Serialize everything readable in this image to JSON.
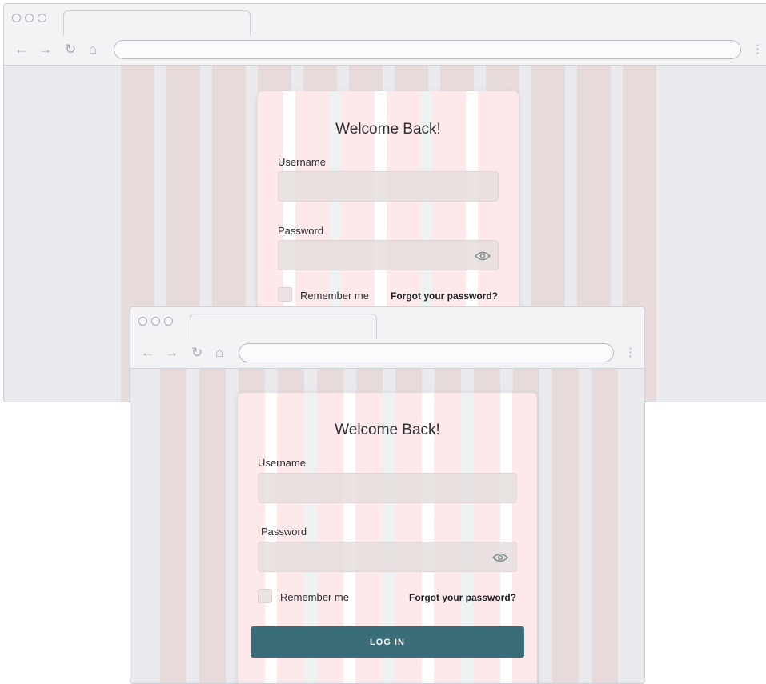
{
  "login_form": {
    "title": "Welcome Back!",
    "username_label": "Username",
    "password_label": "Password",
    "remember_label": "Remember me",
    "forgot_label": "Forgot your password?",
    "login_label": "LOG IN"
  },
  "browser": {
    "nav_icons": [
      "back-arrow-icon",
      "forward-arrow-icon",
      "reload-icon",
      "home-icon"
    ],
    "back_glyph": "←",
    "forward_glyph": "→",
    "reload_glyph": "↻",
    "home_glyph": "⌂",
    "menu_glyph": "⋮"
  },
  "colors": {
    "card_bg": "#fde9ea",
    "page_bg": "#e9e9ee",
    "grid_column": "#e6dada",
    "button": "#3a6c79"
  }
}
